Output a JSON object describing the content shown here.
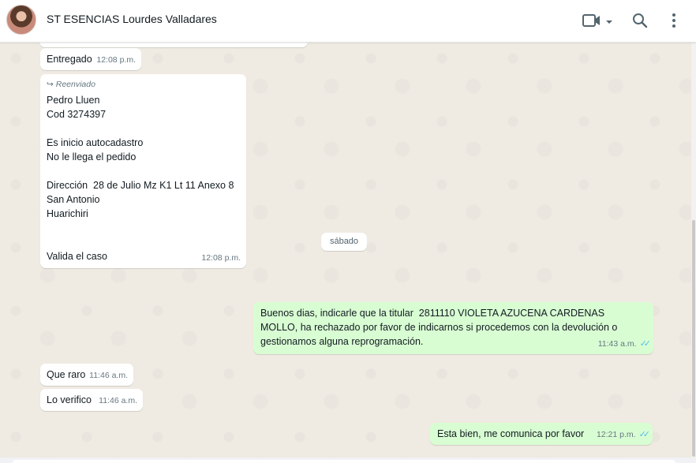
{
  "header": {
    "contact_name": "ST ESENCIAS Lourdes Valladares",
    "icons": [
      "avatar",
      "video-call-icon",
      "chevron-down-icon",
      "search-icon",
      "more-vertical-icon"
    ]
  },
  "messages": [
    {
      "direction": "in",
      "text": "Entregado",
      "time": "12:08 p.m."
    },
    {
      "direction": "in",
      "forwarded_label": "Reenviado",
      "text": "Pedro Lluen\nCod 3274397\n\nEs inicio autocadastro\nNo le llega el pedido\n\nDirección  28 de Julio Mz K1 Lt 11 Anexo 8\nSan Antonio\nHuarichiri\n\n\nValida el caso",
      "time": "12:08 p.m."
    },
    {
      "direction": "day",
      "text": "sábado"
    },
    {
      "direction": "out",
      "text": "Buenos dias, indicarle que la titular  2811110 VIOLETA AZUCENA CARDENAS\nMOLLO, ha rechazado por favor de indicarnos si procedemos con la devolución o\ngestionamos alguna reprogramación.",
      "time": "11:43 a.m.",
      "status": "read"
    },
    {
      "direction": "in",
      "text": "Que raro",
      "time": "11:46 a.m."
    },
    {
      "direction": "in",
      "text": "Lo verifico",
      "time": "11:46 a.m."
    },
    {
      "direction": "out",
      "text": "Esta bien, me comunica por favor",
      "time": "12:21 p.m.",
      "status": "read"
    }
  ],
  "colors": {
    "chat_bg": "#efeae2",
    "incoming_bubble": "#ffffff",
    "outgoing_bubble": "#d9fdd3",
    "read_ticks": "#53bdeb"
  }
}
